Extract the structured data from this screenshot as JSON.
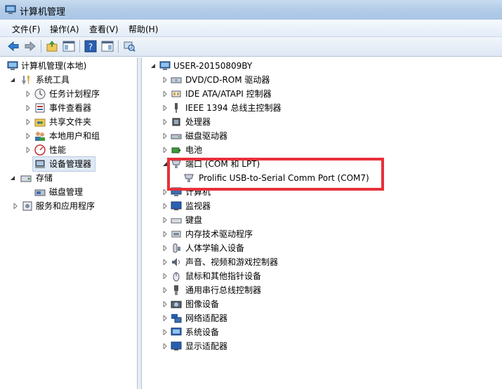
{
  "window": {
    "title": "计算机管理",
    "icon": "computer-management-icon"
  },
  "menu": [
    {
      "label": "文件(F)"
    },
    {
      "label": "操作(A)"
    },
    {
      "label": "查看(V)"
    },
    {
      "label": "帮助(H)"
    }
  ],
  "toolbar": {
    "icons": [
      "back-arrow-icon",
      "forward-arrow-icon",
      "up-folder-icon",
      "show-hide-tree-icon",
      "help-icon",
      "properties-icon",
      "refresh-scan-icon"
    ]
  },
  "left_tree": {
    "root": "计算机管理(本地)",
    "items": [
      {
        "label": "系统工具"
      },
      {
        "label": "任务计划程序"
      },
      {
        "label": "事件查看器"
      },
      {
        "label": "共享文件夹"
      },
      {
        "label": "本地用户和组"
      },
      {
        "label": "性能"
      },
      {
        "label": "设备管理器"
      },
      {
        "label": "存储"
      },
      {
        "label": "磁盘管理"
      },
      {
        "label": "服务和应用程序"
      }
    ]
  },
  "device_tree": {
    "root": "USER-20150809BY",
    "items": [
      {
        "label": "DVD/CD-ROM 驱动器"
      },
      {
        "label": "IDE ATA/ATAPI 控制器"
      },
      {
        "label": "IEEE 1394 总线主控制器"
      },
      {
        "label": "处理器"
      },
      {
        "label": "磁盘驱动器"
      },
      {
        "label": "电池"
      },
      {
        "label": "端口 (COM 和 LPT)"
      },
      {
        "label": "Prolific USB-to-Serial Comm Port (COM7)"
      },
      {
        "label": "计算机"
      },
      {
        "label": "监视器"
      },
      {
        "label": "键盘"
      },
      {
        "label": "内存技术驱动程序"
      },
      {
        "label": "人体学输入设备"
      },
      {
        "label": "声音、视频和游戏控制器"
      },
      {
        "label": "鼠标和其他指针设备"
      },
      {
        "label": "通用串行总线控制器"
      },
      {
        "label": "图像设备"
      },
      {
        "label": "网络适配器"
      },
      {
        "label": "系统设备"
      },
      {
        "label": "显示适配器"
      }
    ]
  },
  "colors": {
    "highlight_box": "#e8303a",
    "selection": "#dfe9f5"
  }
}
